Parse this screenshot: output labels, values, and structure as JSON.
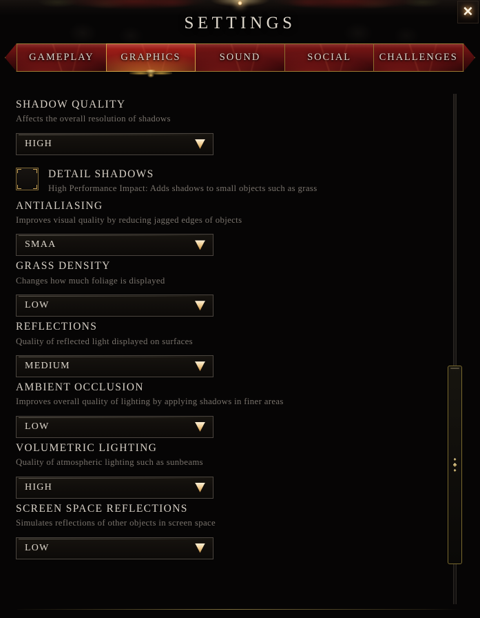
{
  "window": {
    "title": "SETTINGS",
    "close_label": "✕"
  },
  "tabs": [
    {
      "label": "GAMEPLAY",
      "active": false
    },
    {
      "label": "GRAPHICS",
      "active": true
    },
    {
      "label": "SOUND",
      "active": false
    },
    {
      "label": "SOCIAL",
      "active": false
    },
    {
      "label": "CHALLENGES",
      "active": false
    }
  ],
  "settings": [
    {
      "type": "dropdown",
      "label": "SHADOW QUALITY",
      "description": "Affects the overall resolution of shadows",
      "value": "HIGH"
    },
    {
      "type": "checkbox",
      "label": "DETAIL SHADOWS",
      "description": "High Performance Impact: Adds shadows to small objects such as grass",
      "checked": false
    },
    {
      "type": "dropdown",
      "label": "ANTIALIASING",
      "description": "Improves visual quality by reducing jagged edges of objects",
      "value": "SMAA"
    },
    {
      "type": "dropdown",
      "label": "GRASS DENSITY",
      "description": "Changes how much foliage is displayed",
      "value": "LOW"
    },
    {
      "type": "dropdown",
      "label": "REFLECTIONS",
      "description": "Quality of reflected light displayed on surfaces",
      "value": "MEDIUM"
    },
    {
      "type": "dropdown",
      "label": "AMBIENT OCCLUSION",
      "description": "Improves overall quality of lighting by applying shadows in finer areas",
      "value": "LOW"
    },
    {
      "type": "dropdown",
      "label": "VOLUMETRIC LIGHTING",
      "description": "Quality of atmospheric lighting such as sunbeams",
      "value": "HIGH"
    },
    {
      "type": "dropdown",
      "label": "SCREEN SPACE REFLECTIONS",
      "description": "Simulates reflections of other objects in screen space",
      "value": "LOW"
    }
  ],
  "icons": {
    "dropdown_arrow": "chevron-down-icon",
    "close": "close-icon",
    "scrollbar_grip": "grip-dots-icon"
  },
  "colors": {
    "accent_gold": "#cfa85a",
    "tab_red": "#7d1715",
    "tab_active_orange": "#ff9637",
    "text_primary": "#ddd6cb",
    "text_muted": "#79736c",
    "background": "#060505"
  }
}
